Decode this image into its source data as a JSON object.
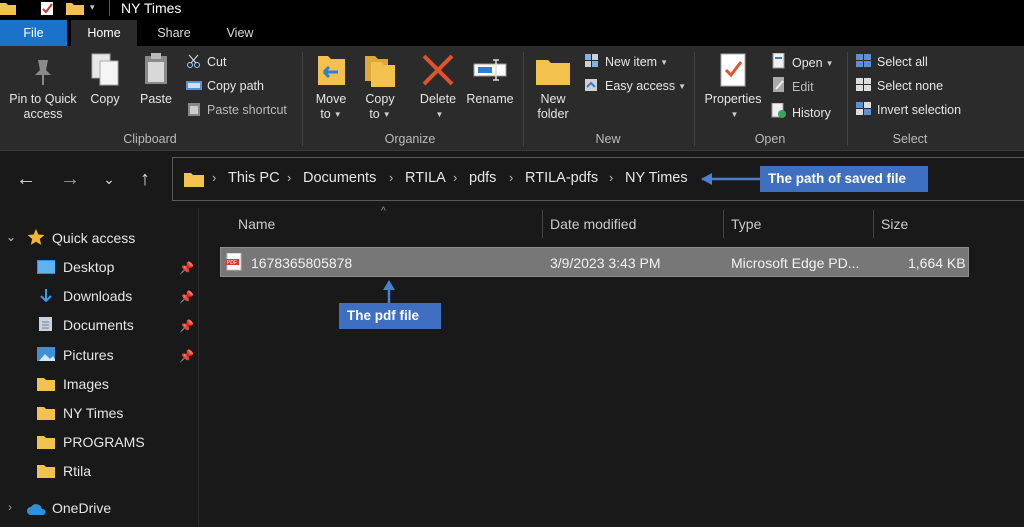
{
  "window": {
    "title": "NY Times"
  },
  "ribbon_tabs": {
    "file": "File",
    "home": "Home",
    "share": "Share",
    "view": "View"
  },
  "clipboard": {
    "pin_line1": "Pin to Quick",
    "pin_line2": "access",
    "copy": "Copy",
    "paste": "Paste",
    "cut": "Cut",
    "copy_path": "Copy path",
    "paste_shortcut": "Paste shortcut",
    "group_label": "Clipboard"
  },
  "organize": {
    "move_line1": "Move",
    "move_line2": "to",
    "copy_line1": "Copy",
    "copy_line2": "to",
    "delete": "Delete",
    "rename": "Rename",
    "group_label": "Organize"
  },
  "new": {
    "folder_line1": "New",
    "folder_line2": "folder",
    "new_item": "New item",
    "easy_access": "Easy access",
    "group_label": "New"
  },
  "open": {
    "properties": "Properties",
    "open": "Open",
    "edit": "Edit",
    "history": "History",
    "group_label": "Open"
  },
  "select": {
    "select_all": "Select all",
    "select_none": "Select none",
    "invert_selection": "Invert selection",
    "group_label": "Select"
  },
  "breadcrumb": [
    "This PC",
    "Documents",
    "RTILA",
    "pdfs",
    "RTILA-pdfs",
    "NY Times"
  ],
  "annotations": {
    "path_callout": "The path of saved file",
    "pdf_callout": "The pdf file"
  },
  "sidebar": {
    "quick_access": "Quick access",
    "items": [
      "Desktop",
      "Downloads",
      "Documents",
      "Pictures",
      "Images",
      "NY Times",
      "PROGRAMS",
      "Rtila"
    ],
    "onedrive": "OneDrive"
  },
  "columns": {
    "name": "Name",
    "date": "Date modified",
    "type": "Type",
    "size": "Size"
  },
  "files": [
    {
      "name": "1678365805878",
      "date": "3/9/2023 3:43 PM",
      "type": "Microsoft Edge PD...",
      "size": "1,664 KB"
    }
  ],
  "colors": {
    "accent": "#1a73c9",
    "callout": "#3f6fc1",
    "folder": "#f2c14e"
  }
}
